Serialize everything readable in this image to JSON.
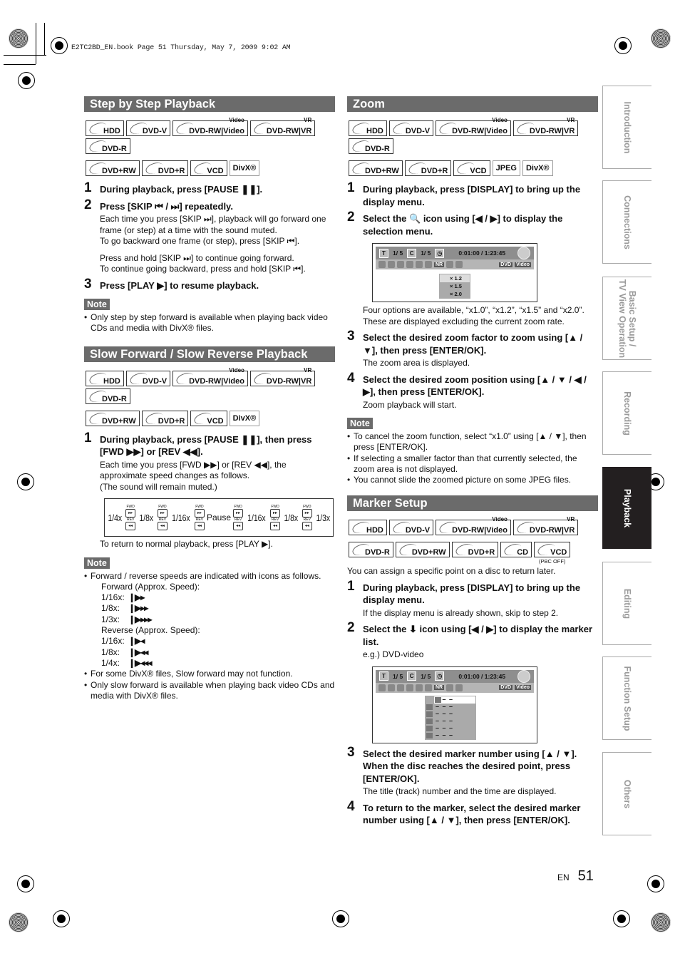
{
  "header": "E2TC2BD_EN.book  Page 51  Thursday, May 7, 2009  9:02 AM",
  "left": {
    "step_by_step": {
      "title": "Step by Step Playback",
      "discs_row1": [
        "HDD",
        "DVD-V",
        "DVD-RW|Video",
        "DVD-RW|VR",
        "DVD-R"
      ],
      "discs_row2": [
        "DVD+RW",
        "DVD+R",
        "VCD"
      ],
      "discs_plain": [
        "DivX®"
      ],
      "steps": [
        {
          "num": "1",
          "text": "During playback, press [PAUSE ❚❚]."
        },
        {
          "num": "2",
          "text": "Press [SKIP ⏮ / ⏭] repeatedly."
        },
        {
          "num": "3",
          "text": "Press [PLAY ▶] to resume playback."
        }
      ],
      "step2_detail": [
        "Each time you press [SKIP ⏭], playback will go forward one frame (or step) at a time with the sound muted.",
        "To go backward one frame (or step), press [SKIP ⏮].",
        "Press and hold [SKIP ⏭] to continue going forward.",
        "To continue going backward, press and hold [SKIP ⏮]."
      ],
      "note_label": "Note",
      "notes": [
        "Only step by step forward is available when playing back video CDs and media with DivX® files."
      ]
    },
    "slow": {
      "title": "Slow Forward / Slow Reverse Playback",
      "discs_row1": [
        "HDD",
        "DVD-V",
        "DVD-RW|Video",
        "DVD-RW|VR",
        "DVD-R"
      ],
      "discs_row2": [
        "DVD+RW",
        "DVD+R",
        "VCD"
      ],
      "discs_plain": [
        "DivX®"
      ],
      "step1": {
        "num": "1",
        "text": "During playback, press [PAUSE ❚❚], then press [FWD ▶▶] or [REV ◀◀]."
      },
      "step1_detail": [
        "Each time you press [FWD ▶▶] or [REV ◀◀], the approximate speed changes as follows.",
        "(The sound will remain muted.)"
      ],
      "speeds": [
        "1/4x",
        "1/8x",
        "1/16x",
        "Pause",
        "1/16x",
        "1/8x",
        "1/3x"
      ],
      "fwd_label": "FWD",
      "rev_label": "REV",
      "return_text": "To return to normal playback, press [PLAY ▶].",
      "note_label": "Note",
      "note1": "Forward / reverse speeds are indicated with icons as follows.",
      "forward_head": "Forward (Approx. Speed):",
      "forward": [
        {
          "speed": "1/16x:",
          "icon": "❙▶▸"
        },
        {
          "speed": "1/8x:",
          "icon": "❙▶▸▸"
        },
        {
          "speed": "1/3x:",
          "icon": "❙▶▸▸▸"
        }
      ],
      "reverse_head": "Reverse (Approx. Speed):",
      "reverse": [
        {
          "speed": "1/16x:",
          "icon": "❙▶◂"
        },
        {
          "speed": "1/8x:",
          "icon": "❙▶◂◂"
        },
        {
          "speed": "1/4x:",
          "icon": "❙▶◂◂◂"
        }
      ],
      "notes_extra": [
        "For some DivX® files, Slow forward may not function.",
        "Only slow forward is available when playing back video CDs and media with DivX® files."
      ]
    }
  },
  "right": {
    "zoom": {
      "title": "Zoom",
      "discs_row1": [
        "HDD",
        "DVD-V",
        "DVD-RW|Video",
        "DVD-RW|VR",
        "DVD-R"
      ],
      "discs_row2": [
        "DVD+RW",
        "DVD+R",
        "VCD"
      ],
      "discs_plain": [
        "JPEG",
        "DivX®"
      ],
      "steps": [
        {
          "num": "1",
          "text": "During playback, press [DISPLAY] to bring up the display menu."
        },
        {
          "num": "2",
          "text": "Select the 🔍 icon using [◀ / ▶] to display the selection menu."
        },
        {
          "num": "3",
          "text": "Select the desired zoom factor to zoom using [▲ / ▼], then press [ENTER/OK]."
        },
        {
          "num": "4",
          "text": "Select the desired zoom position using [▲ / ▼ / ◀ / ▶], then press [ENTER/OK]."
        }
      ],
      "osd": {
        "title_label": "T",
        "title_val": "1/  5",
        "chapter_label": "C",
        "chapter_val": "1/  5",
        "time": "0:01:00 / 1:23:45",
        "nr": "NR",
        "dvd": "DVD",
        "video": "Video",
        "options": [
          "× 1.2",
          "× 1.5",
          "× 2.0"
        ]
      },
      "step2_detail": "Four options are available, “x1.0”, “x1.2”, “x1.5” and “x2.0”. These are displayed excluding the current zoom rate.",
      "step3_detail": "The zoom area is displayed.",
      "step4_detail": "Zoom playback will start.",
      "note_label": "Note",
      "notes": [
        "To cancel the zoom function, select “x1.0” using [▲ / ▼], then press [ENTER/OK].",
        "If selecting a smaller factor than that currently selected, the zoom area is not displayed.",
        "You cannot slide the zoomed picture on some JPEG files."
      ]
    },
    "marker": {
      "title": "Marker Setup",
      "discs_row1": [
        "HDD",
        "DVD-V",
        "DVD-RW|Video",
        "DVD-RW|VR"
      ],
      "discs_row2": [
        "DVD-R",
        "DVD+RW",
        "DVD+R",
        "CD",
        "VCD"
      ],
      "vcd_note": "(PBC OFF)",
      "intro": "You can assign a specific point on a disc to return later.",
      "steps": [
        {
          "num": "1",
          "text": "During playback, press [DISPLAY] to bring up the display menu."
        },
        {
          "num": "2",
          "text": "Select the ⬇ icon using [◀ / ▶] to display the marker list."
        },
        {
          "num": "3",
          "text": "Select the desired marker number using [▲ / ▼]. When the disc reaches the desired point, press [ENTER/OK]."
        },
        {
          "num": "4",
          "text": "To return to the marker, select the desired marker number using [▲ / ▼], then press [ENTER/OK]."
        }
      ],
      "step1_detail": "If the display menu is already shown, skip to step 2.",
      "step2_detail": "e.g.) DVD-video",
      "step3_detail": "The title (track) number and the time are displayed.",
      "osd": {
        "title_label": "T",
        "title_val": "1/  5",
        "chapter_label": "C",
        "chapter_val": "1/  5",
        "time": "0:01:00 / 1:23:45",
        "nr": "NR",
        "dvd": "DVD",
        "video": "Video",
        "markers": [
          "– – –",
          "– – –",
          "– – –",
          "– – –",
          "– – –",
          "– – –"
        ]
      }
    }
  },
  "tabs": [
    {
      "label": "Introduction",
      "active": false
    },
    {
      "label": "Connections",
      "active": false
    },
    {
      "label": "Basic Setup / TV View Operation",
      "active": false
    },
    {
      "label": "Recording",
      "active": false
    },
    {
      "label": "Playback",
      "active": true
    },
    {
      "label": "Editing",
      "active": false
    },
    {
      "label": "Function Setup",
      "active": false
    },
    {
      "label": "Others",
      "active": false
    }
  ],
  "footer": {
    "lang": "EN",
    "page": "51"
  }
}
